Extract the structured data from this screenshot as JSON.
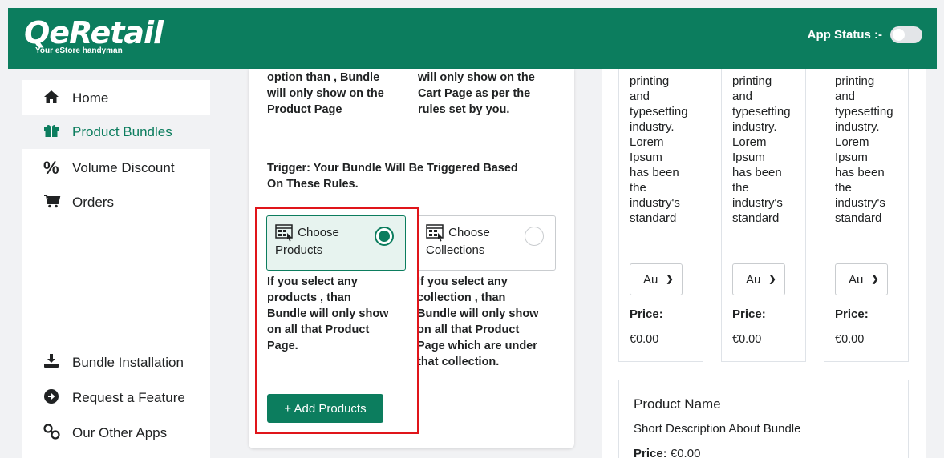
{
  "header": {
    "logo_text": "QeRetail",
    "logo_tagline": "Your eStore handyman",
    "app_status_label": "App Status :-",
    "app_status_on": false
  },
  "sidebar": {
    "items": [
      {
        "label": "Home",
        "icon": "home-icon"
      },
      {
        "label": "Product Bundles",
        "icon": "gift-icon",
        "active": true
      },
      {
        "label": "Volume Discount",
        "icon": "percent-icon"
      },
      {
        "label": "Orders",
        "icon": "cart-icon"
      },
      {
        "label": "Bundle Installation",
        "icon": "download-icon"
      },
      {
        "label": "Request a Feature",
        "icon": "arrow-circle-icon"
      },
      {
        "label": "Our Other Apps",
        "icon": "link-icon"
      }
    ]
  },
  "main": {
    "top_left_text_lines": [
      "option than , Bundle",
      "will only show on the",
      "Product Page"
    ],
    "top_right_text_lines": [
      "will only show on the",
      "Cart Page as per the",
      "rules set by you."
    ],
    "trigger_heading_lines": [
      "Trigger: Your Bundle Will Be Triggered Based",
      "On These Rules."
    ],
    "options": [
      {
        "label_line1": "Choose",
        "label_line2": "Products",
        "selected": true,
        "desc_lines": [
          "If you select any",
          "products , than",
          "Bundle will only show",
          "on all that Product",
          "Page."
        ]
      },
      {
        "label_line1": "Choose",
        "label_line2": "Collections",
        "selected": false,
        "desc_lines": [
          "If you select any",
          "collection , than",
          "Bundle will only show",
          "on all that Product",
          "Page which are under",
          "that collection."
        ]
      }
    ],
    "add_button": "+ Add Products",
    "accent_color": "#0c7d5e",
    "highlight_color": "#e0151a"
  },
  "preview": {
    "product_text_lines": [
      "printing",
      "and",
      "typesetting",
      "industry.",
      "Lorem",
      "Ipsum",
      "has been",
      "the",
      "industry's",
      "standard"
    ],
    "select_value": "Au",
    "price_label": "Price:",
    "price_value": "€0.00",
    "product_card": {
      "title": "Product Name",
      "description": "Short Description About Bundle",
      "price_label": "Price:",
      "price_value": "€0.00"
    }
  }
}
